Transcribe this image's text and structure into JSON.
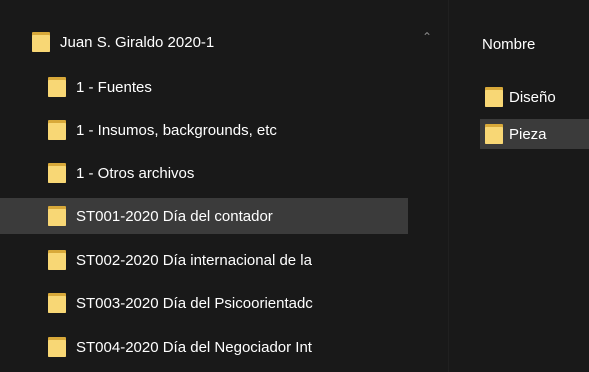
{
  "navigation_pane": {
    "root": {
      "label": "Juan S. Giraldo 2020-1",
      "icon": "folder-icon"
    },
    "children": [
      {
        "label": "1 - Fuentes",
        "icon": "folder-icon",
        "selected": false
      },
      {
        "label": "1 - Insumos, backgrounds, etc",
        "icon": "folder-icon",
        "selected": false
      },
      {
        "label": "1 - Otros archivos",
        "icon": "folder-icon",
        "selected": false
      },
      {
        "label": "ST001-2020 Día del contador",
        "icon": "folder-icon",
        "selected": true
      },
      {
        "label": "ST002-2020 Día internacional de la",
        "icon": "folder-icon",
        "selected": false
      },
      {
        "label": "ST003-2020 Día del Psicoorientadc",
        "icon": "folder-icon",
        "selected": false
      },
      {
        "label": "ST004-2020 Día del Negociador Int",
        "icon": "folder-icon",
        "selected": false
      }
    ],
    "scroll_icon": "chevron-up-icon"
  },
  "content_pane": {
    "column_header": "Nombre",
    "items": [
      {
        "label": "Diseño",
        "icon": "folder-icon",
        "selected": false
      },
      {
        "label": "Pieza",
        "icon": "folder-icon",
        "selected": true
      }
    ]
  },
  "colors": {
    "background": "#191919",
    "selection": "#3b3b3b",
    "folder_front": "#f8d775",
    "folder_back": "#d8a93a",
    "text": "#ffffff"
  }
}
